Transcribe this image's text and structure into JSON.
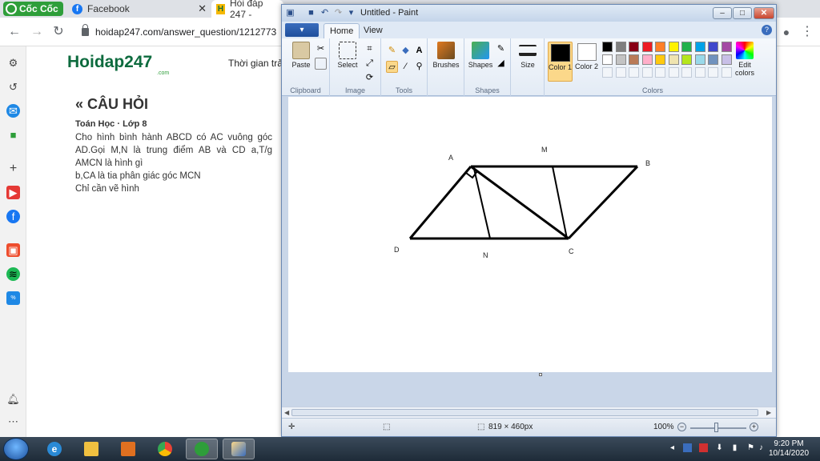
{
  "browser": {
    "brand_label": "Cốc Cốc",
    "tabs": [
      {
        "label": "Facebook"
      },
      {
        "label": "Hỏi đáp 247 -"
      }
    ],
    "url": "hoidap247.com/answer_question/1212773"
  },
  "page": {
    "logo_main": "Hoidap247",
    "logo_sub": ".com",
    "header_text": "Thời gian trả",
    "question_title": "« CÂU HỎI",
    "question_meta": "Toán Học · Lớp 8",
    "question_lines": [
      "Cho hình bình hành ABCD có AC vuông góc AD.Gọi M,N là trung điểm AB và CD a,T/g AMCN là hình gì",
      "b,CA là tia phân giác góc MCN",
      "Chỉ cần vẽ hình"
    ]
  },
  "paint": {
    "title": "Untitled - Paint",
    "file_tab": "▾",
    "tabs": [
      "Home",
      "View"
    ],
    "groups": {
      "clipboard": "Clipboard",
      "image": "Image",
      "tools": "Tools",
      "brushes_group": "",
      "shapes": "Shapes",
      "colors": "Colors"
    },
    "buttons": {
      "paste": "Paste",
      "select": "Select",
      "brushes": "Brushes",
      "shapes": "Shapes",
      "size": "Size",
      "color1": "Color 1",
      "color2": "Color 2",
      "edit_colors": "Edit colors"
    },
    "palette": [
      "#000000",
      "#7f7f7f",
      "#880015",
      "#ed1c24",
      "#ff7f27",
      "#fff200",
      "#22b14c",
      "#00a2e8",
      "#3f48cc",
      "#a349a4",
      "#ffffff",
      "#c3c3c3",
      "#b97a57",
      "#ffaec9",
      "#ffc90e",
      "#efe4b0",
      "#b5e61d",
      "#99d9ea",
      "#7092be",
      "#c8bfe7"
    ],
    "color1_value": "#000000",
    "color2_value": "#ffffff",
    "points": {
      "A": "A",
      "M": "M",
      "B": "B",
      "D": "D",
      "N": "N",
      "C": "C"
    },
    "status": {
      "canvas_size": "819 × 460px",
      "zoom": "100%"
    }
  },
  "taskbar": {
    "time": "9:20 PM",
    "date": "10/14/2020"
  }
}
